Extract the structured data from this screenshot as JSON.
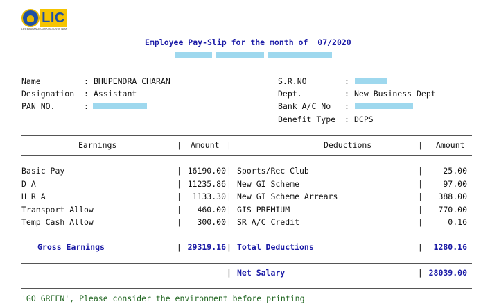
{
  "logo": {
    "brand": "LIC",
    "subtitle": "LIFE INSURANCE CORPORATION OF INDIA",
    "colors": {
      "blue": "#1f4fa3",
      "yellow": "#f5c400"
    }
  },
  "header": {
    "title_prefix": "Employee Pay-Slip for the month of",
    "month": "07/2020"
  },
  "employee": {
    "name_label": "Name",
    "name_value": "BHUPENDRA CHARAN",
    "designation_label": "Designation",
    "designation_value": "Assistant",
    "pan_label": "PAN NO.",
    "srno_label": "S.R.NO",
    "dept_label": "Dept.",
    "dept_value": "New Business Dept",
    "bank_label": "Bank A/C No",
    "benefit_label": "Benefit Type",
    "benefit_value": "DCPS"
  },
  "table": {
    "headers": {
      "earnings": "Earnings",
      "amount1": "Amount",
      "deductions": "Deductions",
      "amount2": "Amount"
    },
    "earnings": [
      {
        "label": "Basic Pay",
        "amount": "16190.00"
      },
      {
        "label": "D A",
        "amount": "11235.86"
      },
      {
        "label": "H R A",
        "amount": "1133.30"
      },
      {
        "label": "Transport Allow",
        "amount": "460.00"
      },
      {
        "label": "Temp Cash Allow",
        "amount": "300.00"
      }
    ],
    "deductions": [
      {
        "label": "Sports/Rec Club",
        "amount": "25.00"
      },
      {
        "label": "New GI Scheme",
        "amount": "97.00"
      },
      {
        "label": "New GI Scheme Arrears",
        "amount": "388.00"
      },
      {
        "label": "GIS PREMIUM",
        "amount": "770.00"
      },
      {
        "label": "SR A/C Credit",
        "amount": "0.16"
      }
    ],
    "totals": {
      "gross_label": "Gross Earnings",
      "gross_amount": "29319.16",
      "ded_label": "Total Deductions",
      "ded_amount": "1280.16",
      "net_label": "Net Salary",
      "net_amount": "28039.00"
    }
  },
  "footer": {
    "note": "'GO GREEN', Please consider the environment before printing"
  }
}
